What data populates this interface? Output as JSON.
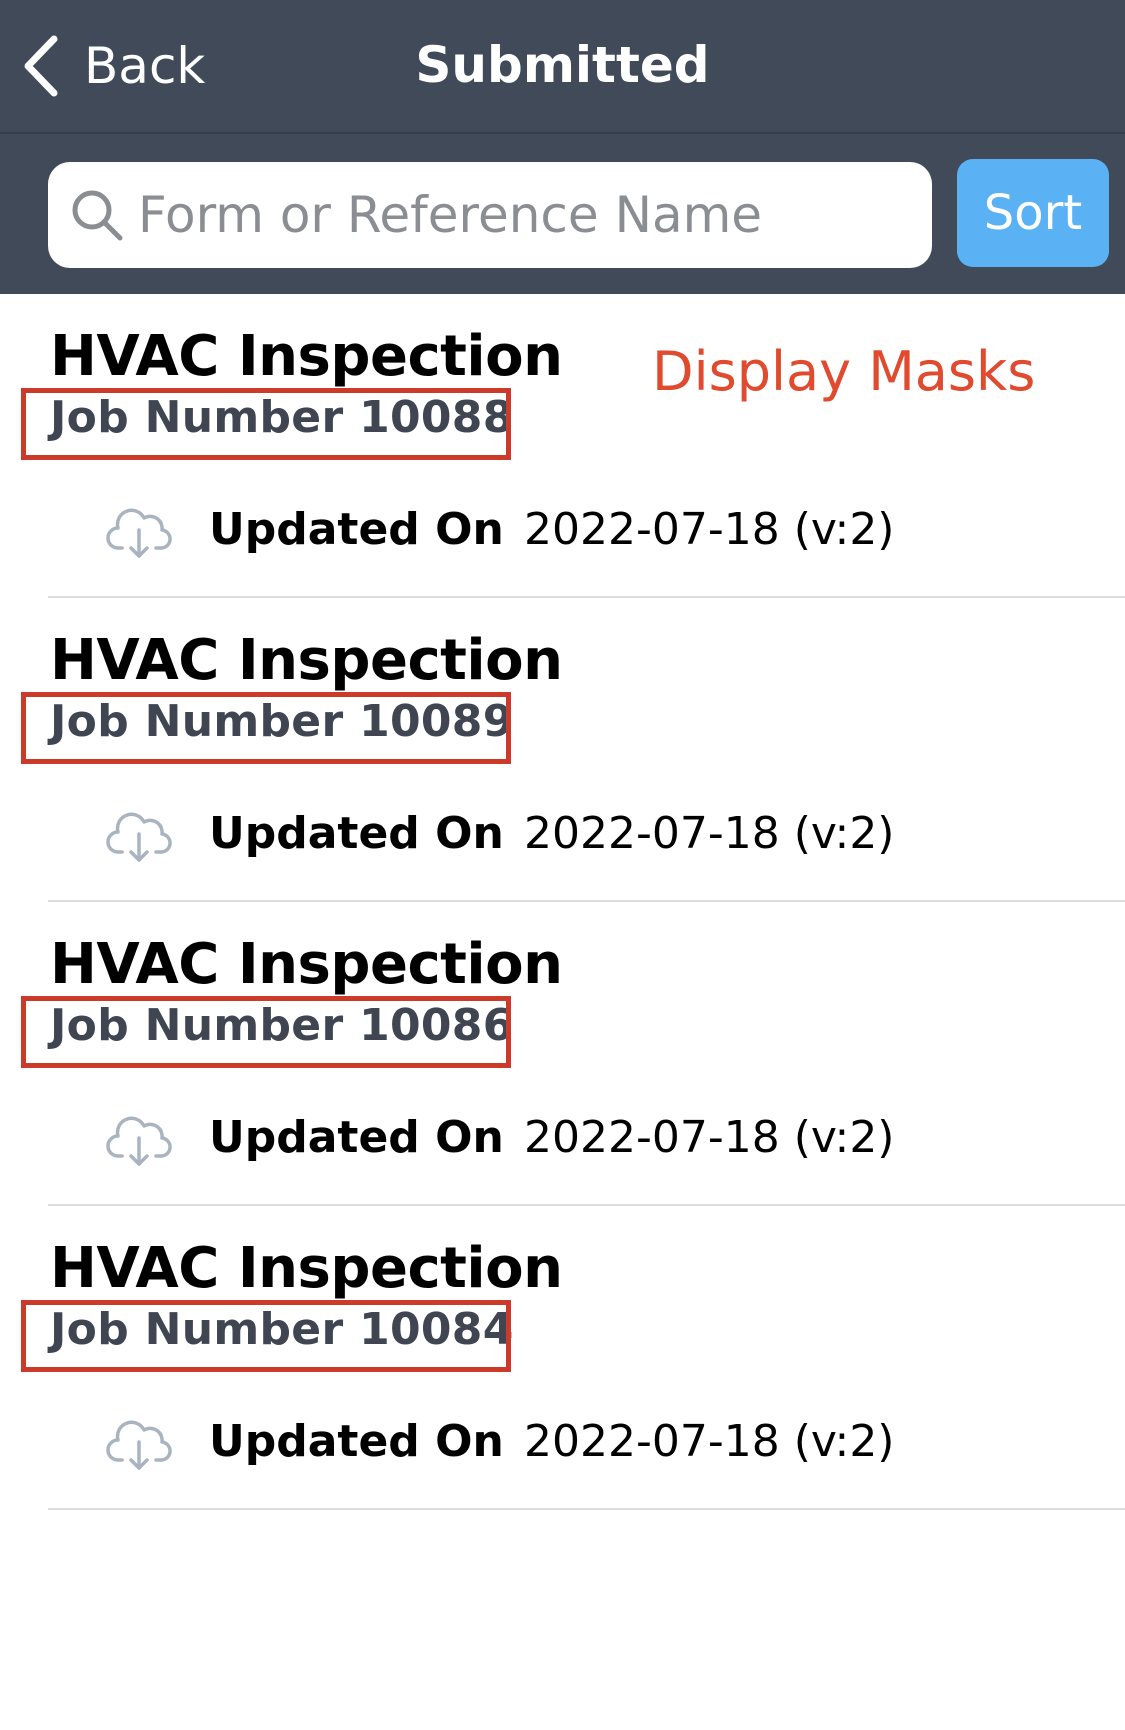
{
  "nav": {
    "back_label": "Back",
    "title": "Submitted"
  },
  "search": {
    "placeholder": "Form or Reference Name",
    "value": ""
  },
  "toolbar": {
    "sort_label": "Sort"
  },
  "annotation": {
    "text": "Display Masks",
    "color": "#e04a2e"
  },
  "items": [
    {
      "title": "HVAC Inspection",
      "subtitle": "Job Number 10088",
      "updated_label": "Updated On",
      "updated_value": "2022-07-18 (v:2)",
      "icon": "cloud-download-icon"
    },
    {
      "title": "HVAC Inspection",
      "subtitle": "Job Number 10089",
      "updated_label": "Updated On",
      "updated_value": "2022-07-18 (v:2)",
      "icon": "cloud-download-icon"
    },
    {
      "title": "HVAC Inspection",
      "subtitle": "Job Number 10086",
      "updated_label": "Updated On",
      "updated_value": "2022-07-18 (v:2)",
      "icon": "cloud-download-icon"
    },
    {
      "title": "HVAC Inspection",
      "subtitle": "Job Number 10084",
      "updated_label": "Updated On",
      "updated_value": "2022-07-18 (v:2)",
      "icon": "cloud-download-icon"
    }
  ],
  "colors": {
    "nav_background": "#414a59",
    "sort_button": "#5ab2f5",
    "mask_outline": "#cc3a2a"
  }
}
